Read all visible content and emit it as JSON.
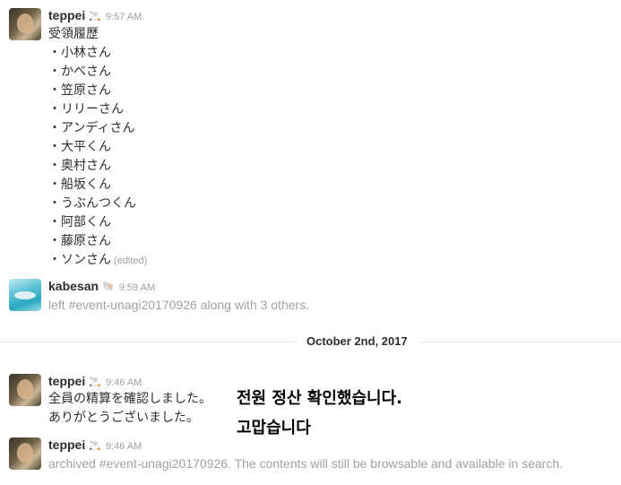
{
  "messages": [
    {
      "author": "teppei",
      "badge": "🚬",
      "time": "9:57 AM",
      "lines": [
        "受領履歴",
        "・小林さん",
        "・かべさん",
        "・笠原さん",
        "・リリーさん",
        "・アンディさん",
        "・大平くん",
        "・奥村さん",
        "・船坂くん",
        "・うぶんつくん",
        "・阿部くん",
        "・藤原さん",
        "・ソンさん"
      ],
      "edited": "(edited)"
    },
    {
      "author": "kabesan",
      "badge": "🐚",
      "time": "9:59 AM",
      "text": "left #event-unagi20170926 along with 3 others."
    },
    {
      "author": "teppei",
      "badge": "🚬",
      "time": "9:46 AM",
      "lines": [
        "全員の精算を確認しました。",
        "ありがとうございました。"
      ]
    },
    {
      "author": "teppei",
      "badge": "🚬",
      "time": "9:46 AM",
      "text": "archived #event-unagi20170926. The contents will still be browsable and available in search."
    }
  ],
  "divider": {
    "label": "October 2nd, 2017"
  },
  "overlay": {
    "line1": "전원 정산 확인했습니다.",
    "line2": "고맙습니다"
  }
}
